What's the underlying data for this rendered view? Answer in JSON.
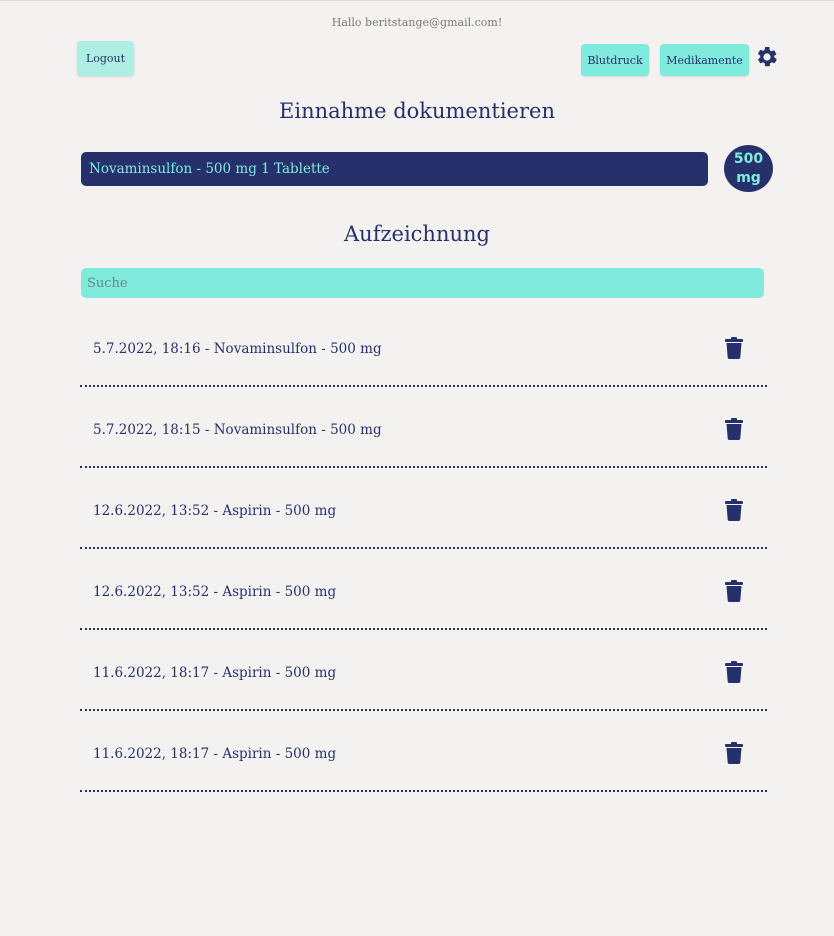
{
  "header": {
    "greeting": "Hallo beritstange@gmail.com!",
    "logout_label": "Logout",
    "nav": [
      "Blutdruck",
      "Medikamente"
    ]
  },
  "intake": {
    "title": "Einnahme dokumentieren",
    "selected_medication": "Novaminsulfon - 500 mg 1 Tablette",
    "dose_value": "500",
    "dose_unit": "mg"
  },
  "records": {
    "title": "Aufzeichnung",
    "search_placeholder": "Suche",
    "entries": [
      "5.7.2022, 18:16 - Novaminsulfon - 500 mg",
      "5.7.2022, 18:15 - Novaminsulfon - 500 mg",
      "12.6.2022, 13:52 - Aspirin - 500 mg",
      "12.6.2022, 13:52 - Aspirin - 500 mg",
      "11.6.2022, 18:17 - Aspirin - 500 mg",
      "11.6.2022, 18:17 - Aspirin - 500 mg"
    ]
  },
  "colors": {
    "primary": "#26306a",
    "accent": "#80ebdc",
    "background": "#f4f2f0"
  },
  "icons": {
    "settings": "gear-icon",
    "delete": "trash-icon"
  }
}
